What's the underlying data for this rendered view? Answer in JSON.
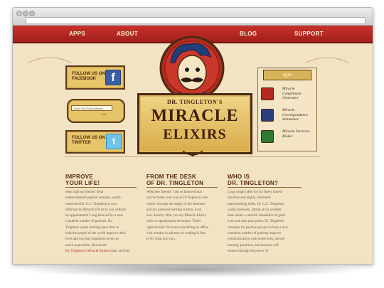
{
  "nav": {
    "apps": "APPS",
    "about": "ABOUT",
    "blog": "BLOG",
    "support": "SUPPORT"
  },
  "social": {
    "facebook_label_1": "FOLLOW US ON",
    "facebook_label_2": "FACEBOOK",
    "email_placeholder": "Enter Your Email Address",
    "join_label": "Join",
    "twitter_label_1": "FOLLOW US ON",
    "twitter_label_2": "TWITTER"
  },
  "logo": {
    "title_small": "DR. TINGLETON'S",
    "title_big_1": "MIRACLE",
    "title_big_2": "ELIXIRS"
  },
  "apps": {
    "header": "apps",
    "items": [
      {
        "label": "Miracle Compliment Generator"
      },
      {
        "label": "Miracle Correspondence Stimulator"
      },
      {
        "label": "Miracle Decision Maker"
      }
    ]
  },
  "columns": {
    "improve": {
      "heading_1": "IMPROVE",
      "heading_2": "YOUR LIFE!",
      "lines": [
        "Step right up friends! Dear",
        "unprecedented popular demand, world-",
        "renowned Dr. G.C. Tingleton is now",
        "offering his Miracle Elixirs to you without",
        "an appointment! Long beloved by a now",
        "countless number of patients, Dr.",
        "Tingleton wants nothing more than to",
        "help the people of the world improve their",
        "lives and increase happiness levels as",
        "much as possible. Download"
      ],
      "link": "Dr. Tingleton's Miracle Elixirs",
      "tail": "today and feel"
    },
    "desk": {
      "heading_1": "FROM THE DESK",
      "heading_2": "OF DR. TINGLETON",
      "lines": [
        "Welcome friends! I am so honored that",
        "you've made your way to DrTingleton.com",
        "where, through the magic of the Internets",
        "and my patented bottling system, I can",
        "now directly offer you my Miracle Elixirs",
        "with no appointment necessary. That's",
        "right friends! No more scheduling an office",
        "visit months in advance or waiting in line",
        "to fix what ails you..."
      ]
    },
    "who": {
      "heading_1": "WHO IS",
      "heading_2": "DR. TINGLETON?",
      "lines": [
        "Long sought after for his finely honed",
        "intuition and highly cultivated",
        "matchmaking skills, Dr. G.C. Tingleton",
        "works tirelessly, sitting at his wooden",
        "desk under a colorful chandelier of god's",
        "eyes and yarn pom poms. Dr. Tingleton",
        "channels his psychic powers to help a now",
        "countless number of patients improve",
        "communication with loved ones, answer",
        "burning questions, and increase self-",
        "esteem through the power of"
      ]
    }
  }
}
